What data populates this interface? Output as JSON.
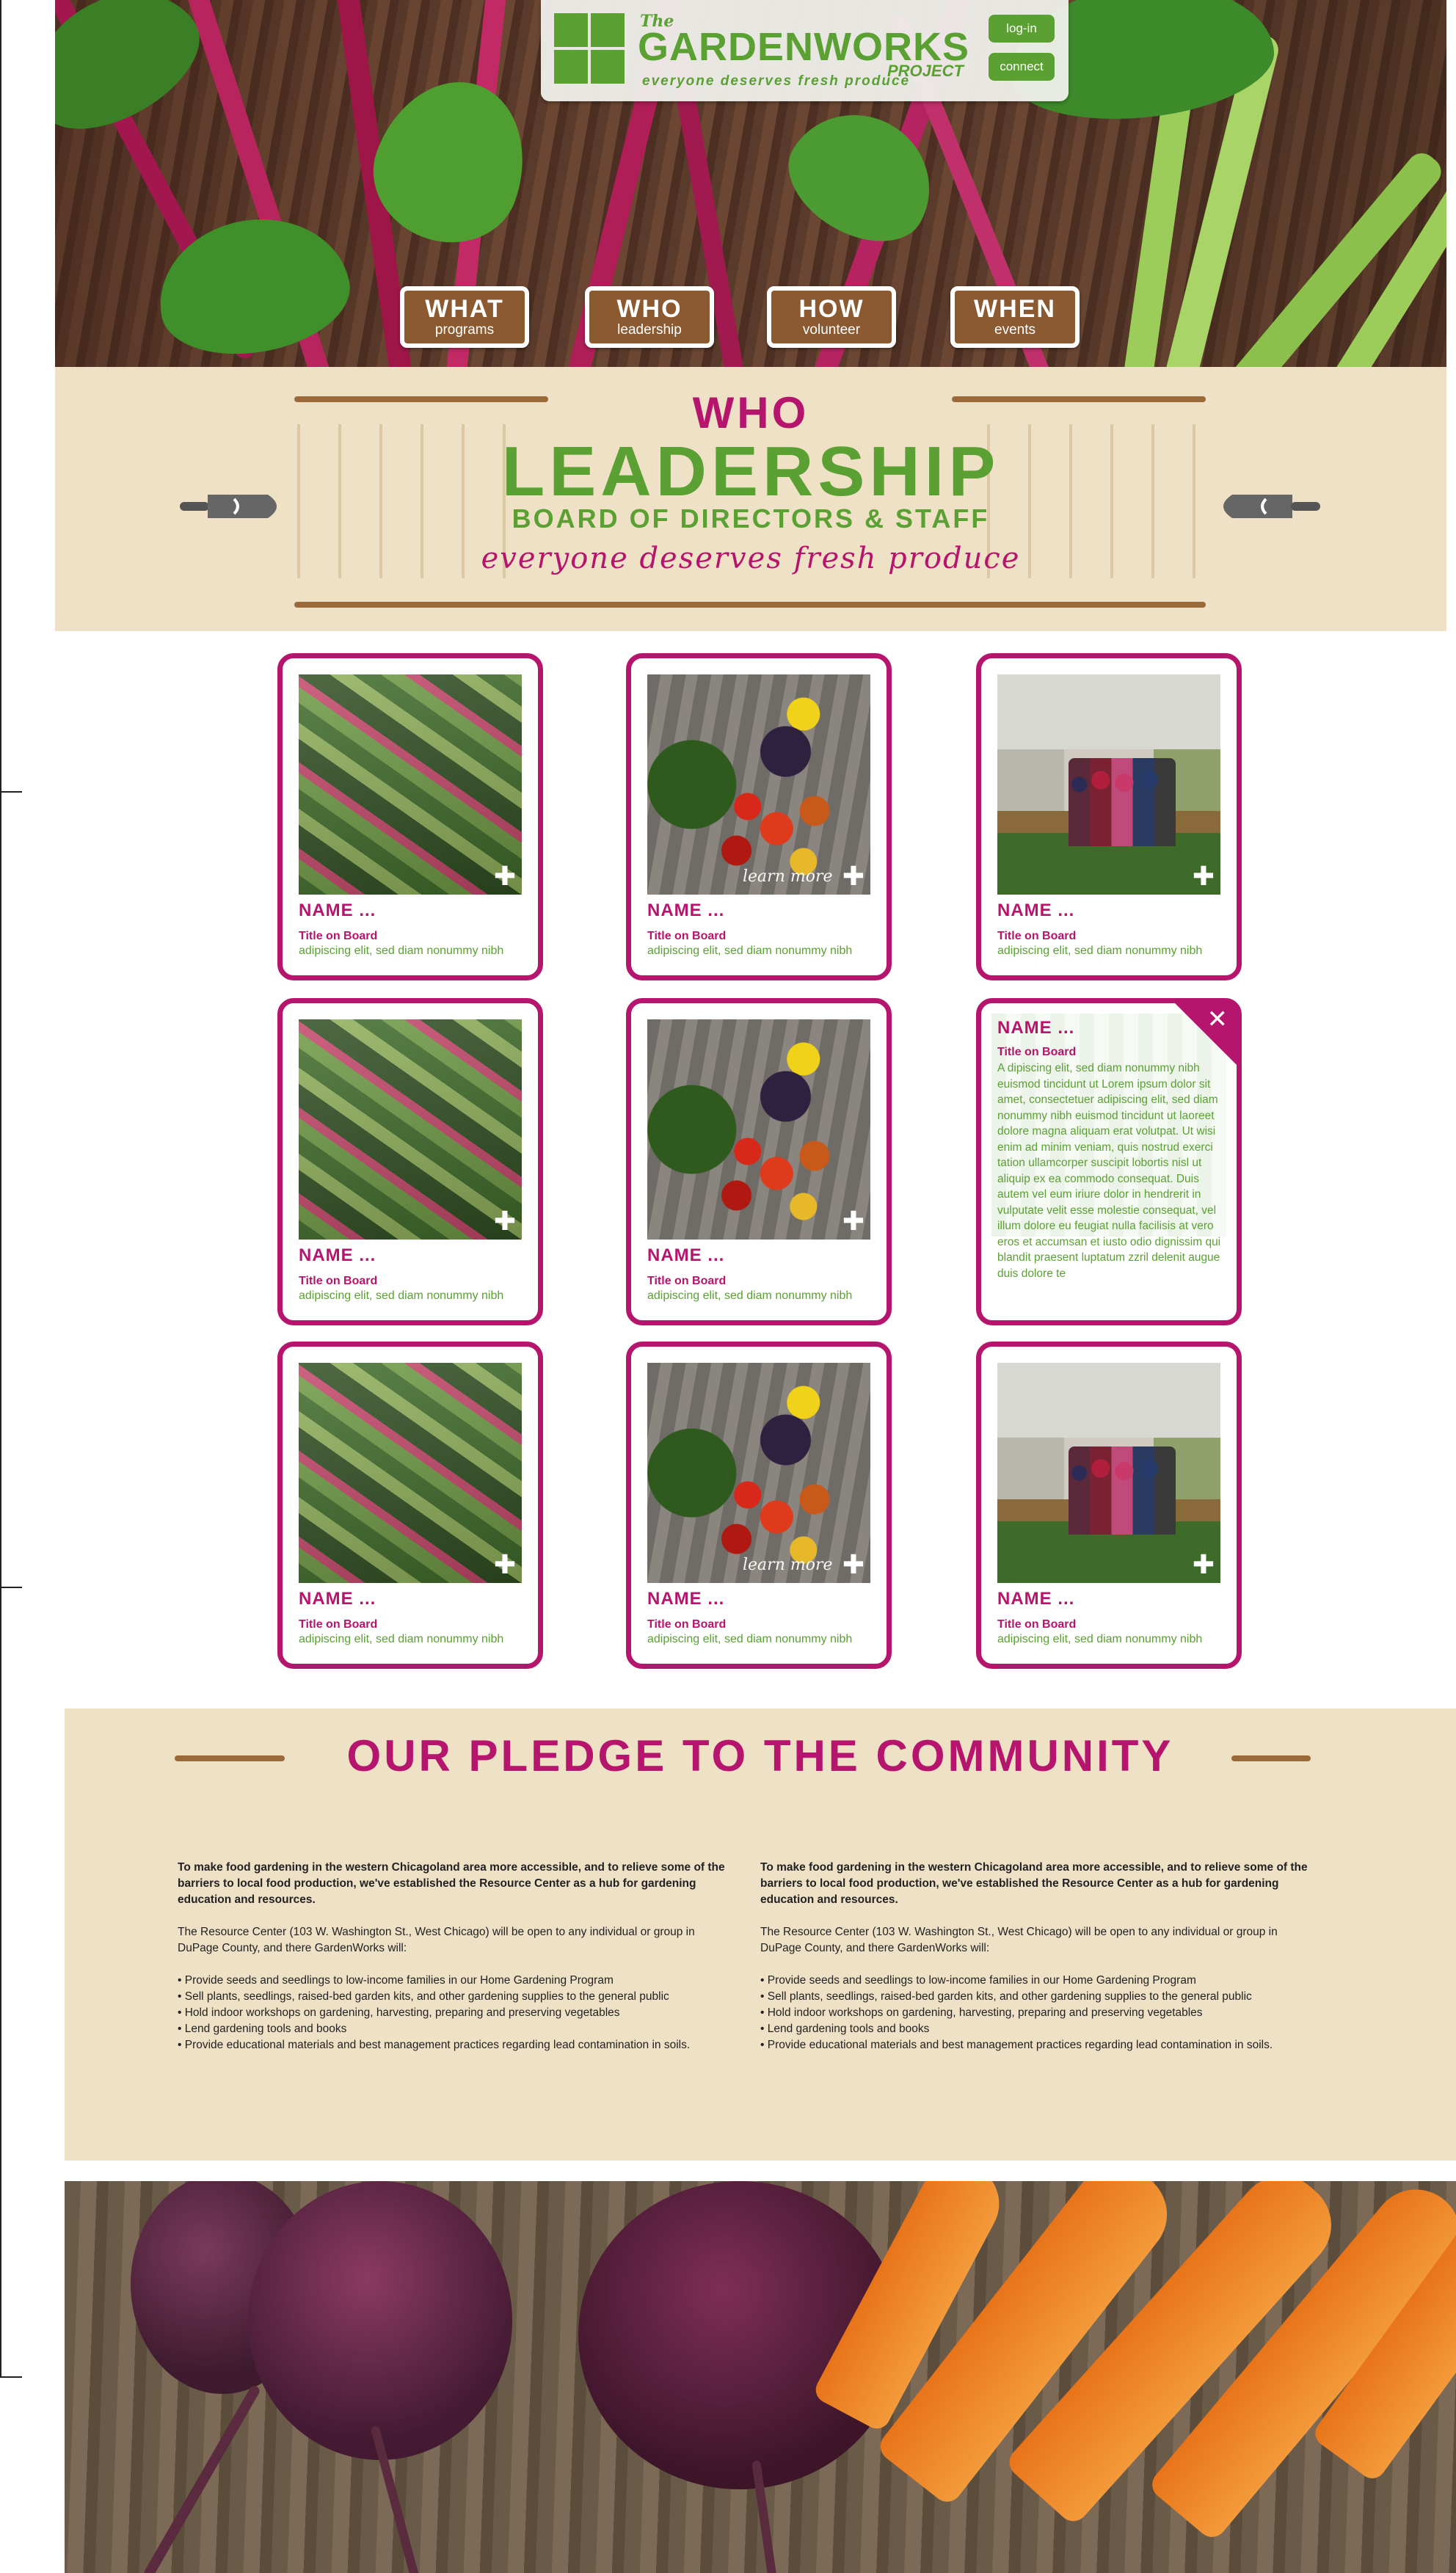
{
  "header": {
    "logo_the": "The",
    "logo_name": "GARDENWORKS",
    "logo_project": "PROJECT",
    "logo_tagline": "everyone deserves fresh produce",
    "login_label": "log-in",
    "connect_label": "connect"
  },
  "nav": [
    {
      "title": "WHAT",
      "subtitle": "programs"
    },
    {
      "title": "WHO",
      "subtitle": "leadership"
    },
    {
      "title": "HOW",
      "subtitle": "volunteer"
    },
    {
      "title": "WHEN",
      "subtitle": "events"
    }
  ],
  "banner": {
    "kicker": "WHO",
    "title": "LEADERSHIP",
    "subtitle": "BOARD OF DIRECTORS & STAFF",
    "script": "everyone deserves fresh produce"
  },
  "cards": [
    {
      "name": "NAME ...",
      "title": "Title on Board",
      "text": "adipiscing elit, sed diam nonummy nibh",
      "photo": "seeds"
    },
    {
      "name": "NAME ...",
      "title": "Title on Board",
      "text": "adipiscing elit, sed diam nonummy nibh",
      "photo": "vegetables",
      "overlay": "learn more"
    },
    {
      "name": "NAME ...",
      "title": "Title on Board",
      "text": "adipiscing elit, sed diam nonummy nibh",
      "photo": "garden"
    },
    {
      "name": "NAME ...",
      "title": "Title on Board",
      "text": "adipiscing elit, sed diam nonummy nibh",
      "photo": "seeds"
    },
    {
      "name": "NAME ...",
      "title": "Title on Board",
      "text": "adipiscing elit, sed diam nonummy nibh",
      "photo": "vegetables"
    },
    {
      "name": "NAME ...",
      "title": "Title on Board",
      "text": "adipiscing elit, sed diam nonummy nibh",
      "photo": "garden"
    },
    {
      "name": "NAME ...",
      "title": "Title on Board",
      "text": "adipiscing elit, sed diam nonummy nibh",
      "photo": "vegetables",
      "overlay": "learn more"
    },
    {
      "name": "NAME ...",
      "title": "Title on Board",
      "text": "adipiscing elit, sed diam nonummy nibh",
      "photo": "garden"
    }
  ],
  "expanded_card": {
    "name": "NAME ...",
    "title": "Title on Board",
    "body": "A dipiscing elit, sed diam nonummy nibh euismod tincidunt ut Lorem ipsum dolor sit amet, consectetuer adipiscing elit, sed diam nonummy nibh euismod tincidunt ut laoreet dolore magna aliquam erat volutpat. Ut wisi enim ad minim veniam, quis nostrud exerci tation ullamcorper suscipit lobortis nisl ut aliquip ex ea commodo consequat. Duis autem vel eum iriure dolor in hendrerit in vulputate velit esse molestie consequat, vel illum dolore eu feugiat nulla facilisis at vero eros et accumsan et iusto odio dignissim qui blandit praesent luptatum zzril delenit augue duis dolore te"
  },
  "pledge": {
    "title": "OUR PLEDGE TO THE COMMUNITY",
    "columns": [
      {
        "lead": "To make food gardening in the western Chicagoland area more accessible, and to relieve some of the barriers to local food production,  we've established the Resource Center as a hub for gardening education and resources.",
        "intro": "The Resource Center (103 W. Washington St., West Chicago) will be open to any individual or group in DuPage County, and there GardenWorks will:",
        "items": [
          "Provide seeds and seedlings to low-income families in our Home Gardening Program",
          "Sell plants, seedlings, raised-bed garden kits, and other gardening supplies to the general public",
          "Hold indoor workshops on gardening, harvesting, preparing and preserving vegetables",
          "Lend gardening tools and books",
          "Provide educational materials and best management practices regarding lead contamination in soils."
        ]
      },
      {
        "lead": "To make food gardening in the western Chicagoland area more accessible, and to relieve some of the barriers to local food production,  we've established the Resource Center as a hub for gardening education and resources.",
        "intro": "The Resource Center (103 W. Washington St., West Chicago) will be open to any individual or group in DuPage County, and there GardenWorks will:",
        "items": [
          "Provide seeds and seedlings to low-income families in our Home Gardening Program",
          "Sell plants, seedlings, raised-bed garden kits, and other gardening supplies to the general public",
          "Hold indoor workshops on gardening, harvesting, preparing and preserving vegetables",
          "Lend gardening tools and books",
          "Provide educational materials and best management practices regarding lead contamination in soils."
        ]
      }
    ]
  },
  "colors": {
    "magenta": "#b5156d",
    "green": "#5aa032",
    "brown": "#8b5a30",
    "cream": "#efe1c6"
  }
}
